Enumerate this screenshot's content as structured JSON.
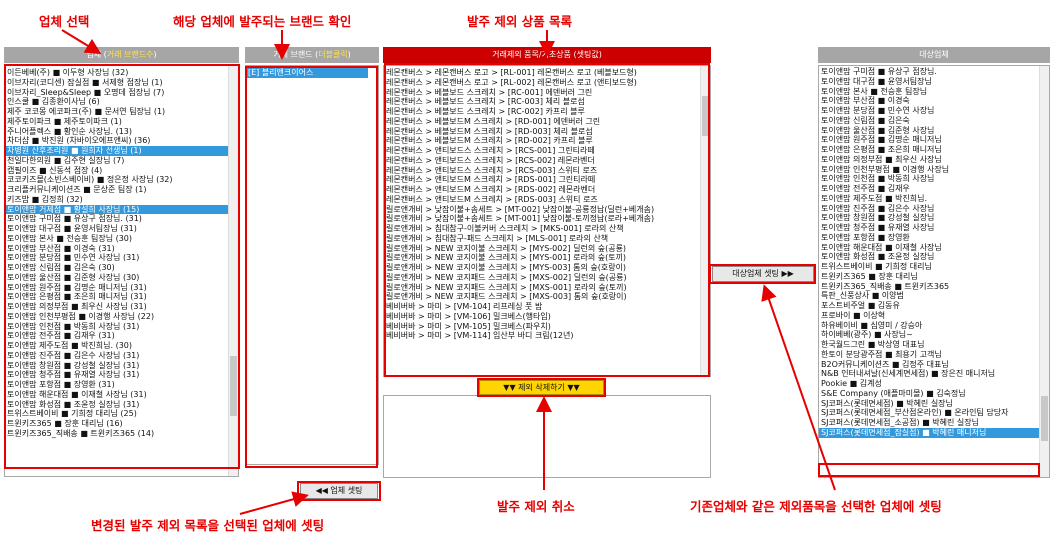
{
  "annotations": {
    "vendor_select": "업체 선택",
    "brand_check": "해당 업체에 발주되는 브랜드 확인",
    "exclude_list": "발주 제외 상품 목록",
    "apply_changed": "변경된 발주 제외 목록을 선택된 업체에 셋팅",
    "cancel_exclude": "발주 제외 취소",
    "apply_same": "기존업체와 같은 제외품목을 선택한 업체에 셋팅"
  },
  "panels": {
    "vendor": {
      "title_prefix": "업체 (",
      "title_highlight": "거래 브랜드수",
      "title_suffix": ")"
    },
    "brand": {
      "title_prefix": "거래 브랜드 (",
      "title_highlight": "더블클릭",
      "title_suffix": ")"
    },
    "exclude": {
      "title": "거래제외 품목/기초상품 (셋팅값)"
    },
    "target": {
      "title": "대상업체"
    }
  },
  "buttons": {
    "vendor_set": "◀◀ 업체 셋팅",
    "delete_exclude": "▼▼ 제외 삭제하기 ▼▼",
    "target_set": "대상업체 셋팅 ▶▶"
  },
  "vendor_list": [
    "이든베베(주) ■ 이두형 사장님 (32)",
    "이브자리(코디센) 잠실점 ■ 서제형 점장님 (1)",
    "이브자리_Sleep&Sleep ■ 오명데 점장님 (7)",
    "인스쿨 ■ 김종환이사님 (6)",
    "제주 코코몽 에코파크(주) ■ 문서연 팀장님 (1)",
    "제주토이파크 ■ 제주토이파크 (1)",
    "주니어플렉스 ■ 황인순 사장님. (13)",
    "차더샵 ■ 박진원 (차바이오에프앤씨) (36)",
    "차병원 산후조리원 ■ 원희자 선생님 (1)",
    "천일다한의원 ■ 김주현 실장님 (7)",
    "캡필이즈 ■ 신동석 점장 (4)",
    "코코키즈몰(소빈스베이비) ■ 정은정 사장님 (32)",
    "크리플커뮤니케이션즈 ■ 문상준 팀장 (1)",
    "키즈밥 ■ 김정희 (32)",
    "토이앤맘 거제점 ■ 황설희 사장님 (15)",
    "토이앤맘 구미점 ■ 유상구 점장님. (31)",
    "토이앤맘 대구점 ■ 윤영서팀장님 (31)",
    "토이앤맘 본사 ■ 전승훈 팀장님 (30)",
    "토이앤맘 부산점 ■ 이경숙 (31)",
    "토이앤맘 분당점 ■ 민수연 사장님 (31)",
    "토이앤맘 신림점 ■ 김은숙 (30)",
    "토이앤맘 울산점 ■ 김준형 사장님 (30)",
    "토이앤맘 원주점 ■ 김명순 매니저님 (31)",
    "토이앤맘 은평점 ■ 조은희 매니저님 (31)",
    "토이앤맘 의정부점 ■ 최우신 사장님 (31)",
    "토이앤맘 인천부평점 ■ 이경행 사장님 (22)",
    "토이앤맘 인천점 ■ 박동희 사장님 (31)",
    "토이앤맘 전주점 ■ 김재우 (31)",
    "토이앤맘 제주도점 ■ 박진희님. (30)",
    "토이앤맘 진주점 ■ 김은수 사장님 (31)",
    "토이앤맘 창원점 ■ 강성철 실장님 (31)",
    "토이앤맘 청주점 ■ 유재열 사장님 (31)",
    "토이앤맘 포항점 ■ 장영환 (31)",
    "토이앤맘 해운대점 ■ 이재철 사장님 (31)",
    "토이앤맘 화성점 ■ 조윤정 실장님 (31)",
    "트위스트베이비 ■ 기희정 대리님 (25)",
    "트윈키즈365 ■ 장훈 대리님 (16)",
    "트윈키즈365_직배송 ■ 트윈키즈365 (14)"
  ],
  "brand_list": [
    "[E] 블리앤크이어스"
  ],
  "exclude_list": [
    "레몬캔버스 > 레몬캔버스 로고 > [RL-001] 레몬캔버스 로고 (베블보드형)",
    "레몬캔버스 > 레몬캔버스 로고 > [RL-002] 레몬캔버스 로고 (앤티보드형)",
    "레몬캔버스 > 베블보드 스크레치 > [RC-001] 에덴버러 그린",
    "레몬캔버스 > 베블보드 스크레치 > [RC-003] 체리 블로섬",
    "레몬캔버스 > 베블보드 스크레치 > [RC-002] 카프리 블루",
    "레몬캔버스 > 베블보드M 스크레치 > [RD-001] 에덴버러 그린",
    "레몬캔버스 > 베블보드M 스크레치 > [RD-003] 체리 블로섬",
    "레몬캔버스 > 베블보드M 스크레치 > [RD-002] 카프리 블루",
    "레몬캔버스 > 앤티보드스 스크레치 > [RCS-001] 그린티라떼",
    "레몬캔버스 > 앤티보드스 스크레치 > [RCS-002] 레몬라벤더",
    "레몬캔버스 > 앤티보드스 스크레치 > [RCS-003] 스위티 로즈",
    "레몬캔버스 > 앤티보드M 스크레치 > [RDS-001] 그린티라떼",
    "레몬캔버스 > 앤티보드M 스크레치 > [RDS-002] 레몬라벤더",
    "레몬캔버스 > 앤티보드M 스크레치 > [RDS-003] 스위티 로즈",
    "릴로앤개비 > 낮잠이불+솜세트 > [MT-002] 낮잠이불-공룡정납(딜런+베개솜)",
    "릴로앤개비 > 낮잠이불+솜세트 > [MT-001] 낮잠이불-토끼정납(로라+베개솜)",
    "릴로앤개비 > 침대참구-이불커버 스크레치 > [MKS-001] 로라의 산책",
    "릴로앤개비 > 침대참구-패드 스크레치 > [MLS-001] 로라의 산책",
    "릴로앤개비 > NEW 코지이불 스크레치 > [MYS-002] 딜런의 숲(공룡)",
    "릴로앤개비 > NEW 코지이불 스크레치 > [MYS-001] 로라의 숲(토끼)",
    "릴로앤개비 > NEW 코지이불 스크레치 > [MYS-003] 톰의 숲(호랑이)",
    "릴로앤개비 > NEW 코지패드 스크레치 > [MXS-002] 딜런의 숲(공룡)",
    "릴로앤개비 > NEW 코지패드 스크레치 > [MXS-001] 로라의 숲(토끼)",
    "릴로앤개비 > NEW 코지패드 스크레치 > [MXS-003] 톰의 숲(호랑이)",
    "베비버바 > 마미 > [VM-104] 리프레싱 풋 밤",
    "베비버바 > 마미 > [VM-106] 밀크베스(행타입)",
    "베비버바 > 마미 > [VM-105] 밀크베스(파우치)",
    "베비버바 > 마미 > [VM-114] 임산부 바디 크림(12년)"
  ],
  "target_list": [
    "토이앤맘 구미점 ■ 유상구 점장님.",
    "토이앤맘 대구점 ■ 윤영서팀장님",
    "토이앤맘 본사 ■ 전승훈 팀장님",
    "토이앤맘 부산점 ■ 이경숙",
    "토이앤맘 분당점 ■ 민수연 사장님",
    "토이앤맘 신림점 ■ 김은숙",
    "토이앤맘 울산점 ■ 김준형 사장님",
    "토이앤맘 원주점 ■ 김명순 매니저님",
    "토이앤맘 은평점 ■ 조은희 매니저님",
    "토이앤맘 의정부점 ■ 최우신 사장님",
    "토이앤맘 인천부평점 ■ 이경행 사장님",
    "토이앤맘 인천점 ■ 박동희 사장님",
    "토이앤맘 전주점 ■ 김재우",
    "토이앤맘 제주도점 ■ 박진희님.",
    "토이앤맘 진주점 ■ 김은수 사장님",
    "토이앤맘 창원점 ■ 강성철 실장님",
    "토이앤맘 청주점 ■ 유재열 사장님",
    "토이앤맘 포항점 ■ 장영환",
    "토이앤맘 해운대점 ■ 이재철 사장님",
    "토이앤맘 화성점 ■ 조윤정 실장님",
    "트위스트베이비 ■ 기희정 대리님",
    "트윈키즈365 ■ 장훈 대리님",
    "트윈키즈365_직배송 ■ 트윈키즈365",
    "특판_신풍상사 ■ 이양범",
    "포스트비주얼 ■ 김동유",
    "프로바이 ■ 이상혁",
    "하유베이비 ■ 심영미 / 강승아",
    "하이베베(광주) ■ 사장님~",
    "한국월드그린 ■ 박상영 대표님",
    "한토이 분당광주점 ■ 최용기 고객님",
    "B2O커뮤니케이션즈 ■ 김정주 대표님",
    "N&B 인터내셔날(신세계면세점) ■ 장은진 매니저님",
    "Pookie ■ 김계성",
    "S&E Company (애플마미몰) ■ 김숙정님",
    "SJ코퍼스(롯데면세점) ■ 박혜린 실장님",
    "SJ코퍼스(롯데면세점_부산점온라인) ■ 온라인팀 담당자",
    "SJ코퍼스(롯데면세점_소공점) ■ 박혜린 실장님",
    "SJ코퍼스(롯데면세점_잠실점) ■ 박혜린 매니저님"
  ]
}
